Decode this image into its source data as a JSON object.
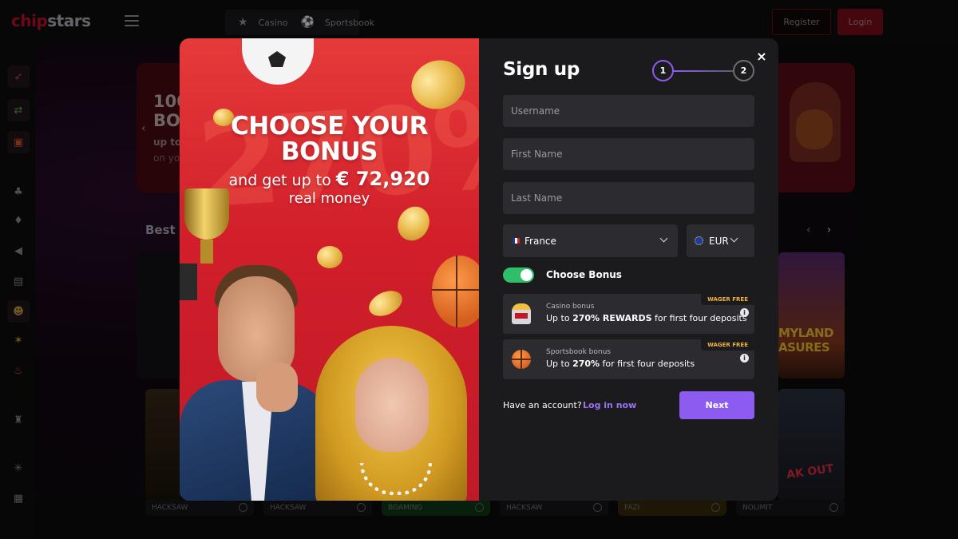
{
  "header": {
    "logo_part1": "chip",
    "logo_part2": "stars",
    "nav": [
      {
        "label": "Casino",
        "icon": "star-icon"
      },
      {
        "label": "Sportsbook",
        "icon": "soccer-ball-icon"
      }
    ],
    "register_label": "Register",
    "login_label": "Login"
  },
  "background": {
    "banner": {
      "line1": "100",
      "line2": "BO",
      "line3": "up to",
      "line4": "on yo"
    },
    "section_title": "Best G",
    "game_titles": [
      "MYLAND",
      "ASURES",
      "AK OUT"
    ],
    "providers": [
      "HACKSAW",
      "HACKSAW",
      "BGAMING",
      "HACKSAW",
      "FAZI",
      "NOLIMIT"
    ]
  },
  "promo": {
    "headline_line1": "CHOOSE YOUR",
    "headline_line2": "BONUS",
    "sub_prefix": "and get up to ",
    "amount": "€ 72,920",
    "sub_line2": "real money",
    "bg_text": "270%"
  },
  "form": {
    "title": "Sign up",
    "steps": [
      "1",
      "2"
    ],
    "close_icon": "×",
    "fields": {
      "username_placeholder": "Username",
      "first_name_placeholder": "First Name",
      "last_name_placeholder": "Last Name"
    },
    "country": "France",
    "currency": "EUR",
    "choose_bonus_label": "Choose Bonus",
    "choose_bonus_enabled": true,
    "bonuses": [
      {
        "kicker": "Casino bonus",
        "prefix": "Up to ",
        "highlight": "270% REWARDS",
        "suffix": " for first four deposits",
        "badge": "WAGER FREE",
        "icon": "slot-machine-icon"
      },
      {
        "kicker": "Sportsbook bonus",
        "prefix": "Up to ",
        "highlight": "270%",
        "suffix": " for first four deposits",
        "badge": "WAGER FREE",
        "icon": "basketball-icon"
      }
    ],
    "have_account": "Have an account?",
    "login_link": "Log in now",
    "next_label": "Next"
  },
  "colors": {
    "accent": "#8c5cf0",
    "toggle_on": "#2fbf6a",
    "brand_red": "#c8102e",
    "badge": "#f0b23a"
  }
}
